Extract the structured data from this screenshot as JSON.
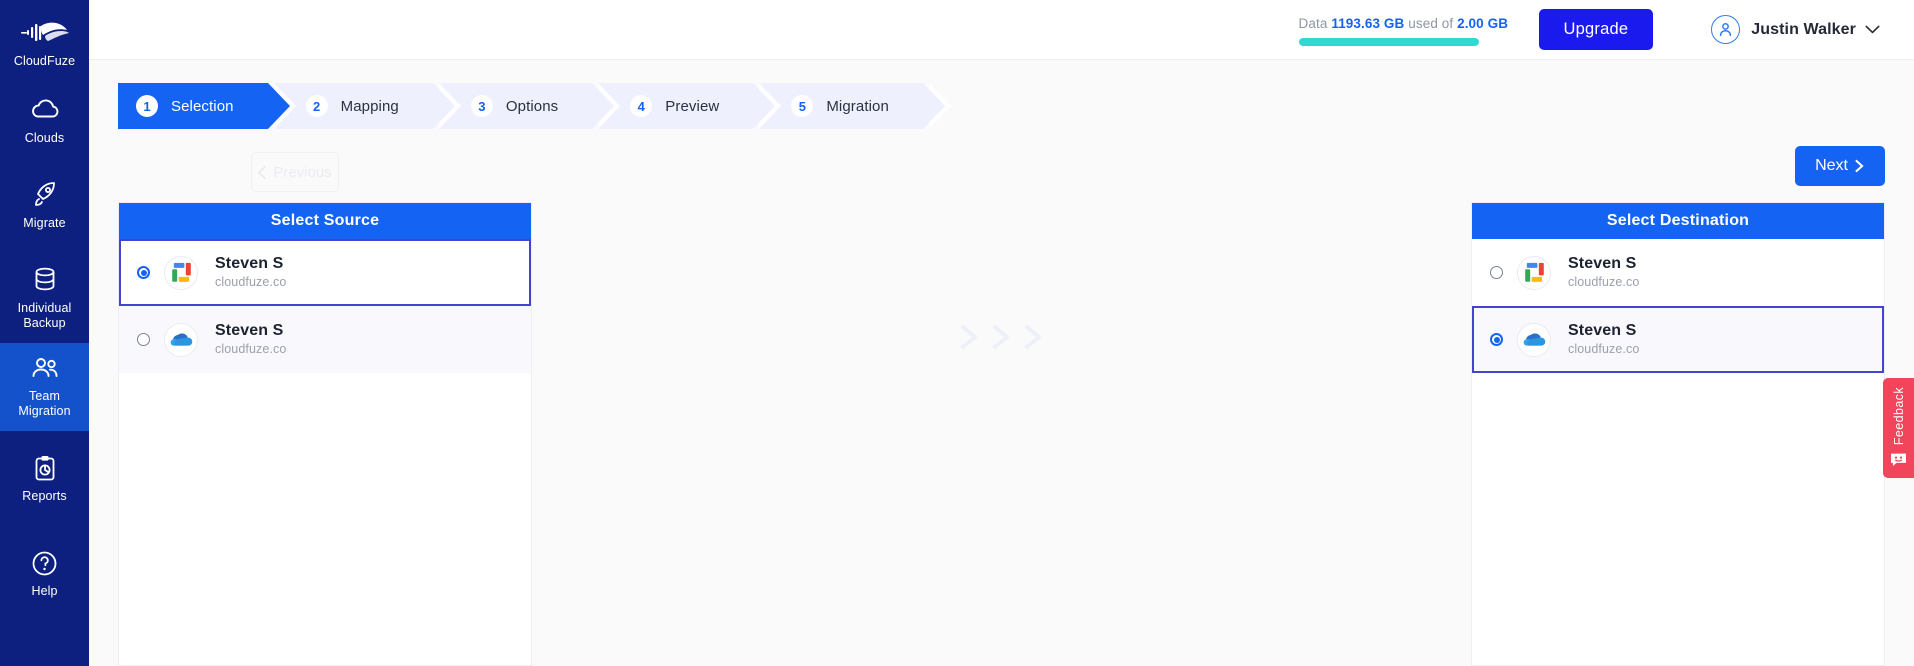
{
  "sidebar": {
    "brand": {
      "label": "CloudFuze",
      "icon": "cloudfuze-logo-icon"
    },
    "items": [
      {
        "label": "Clouds",
        "icon": "cloud-icon",
        "active": false
      },
      {
        "label": "Migrate",
        "icon": "rocket-icon",
        "active": false
      },
      {
        "label": "Individual Backup",
        "icon": "database-icon",
        "active": false
      },
      {
        "label": "Team Migration",
        "icon": "users-icon",
        "active": true
      },
      {
        "label": "Reports",
        "icon": "clipboard-chart-icon",
        "active": false
      },
      {
        "label": "Help",
        "icon": "question-circle-icon",
        "active": false
      }
    ]
  },
  "header": {
    "storage_prefix": "Data",
    "storage_used": "1193.63 GB",
    "storage_middle": "used of",
    "storage_total": "2.00 GB",
    "storage_percent": 100,
    "upgrade_label": "Upgrade",
    "user_name": "Justin Walker",
    "avatar_icon": "user-circle-icon",
    "chevron_icon": "chevron-down-icon",
    "accent_color": "#1463f3",
    "progress_color": "#2ed9d2"
  },
  "steps": [
    {
      "num": "1",
      "label": "Selection",
      "active": true
    },
    {
      "num": "2",
      "label": "Mapping",
      "active": false
    },
    {
      "num": "3",
      "label": "Options",
      "active": false
    },
    {
      "num": "4",
      "label": "Preview",
      "active": false
    },
    {
      "num": "5",
      "label": "Migration",
      "active": false
    }
  ],
  "nav": {
    "previous_label": "Previous",
    "previous_disabled": true,
    "previous_icon": "chevron-left-icon",
    "next_label": "Next",
    "next_icon": "chevron-right-icon"
  },
  "source_panel": {
    "title": "Select Source",
    "accounts": [
      {
        "name": "Steven S",
        "domain": "cloudfuze.co",
        "provider_icon": "google-workspace-icon",
        "selected": true
      },
      {
        "name": "Steven S",
        "domain": "cloudfuze.co",
        "provider_icon": "onedrive-icon",
        "selected": false
      }
    ]
  },
  "destination_panel": {
    "title": "Select Destination",
    "accounts": [
      {
        "name": "Steven S",
        "domain": "cloudfuze.co",
        "provider_icon": "google-workspace-icon",
        "selected": false
      },
      {
        "name": "Steven S",
        "domain": "cloudfuze.co",
        "provider_icon": "onedrive-icon",
        "selected": true
      }
    ]
  },
  "transfer_arrows": {
    "icon": "double-chevron-right-icon",
    "count": 3
  },
  "feedback": {
    "label": "Feedback",
    "icon": "smiley-chat-icon",
    "color": "#f2455c"
  }
}
